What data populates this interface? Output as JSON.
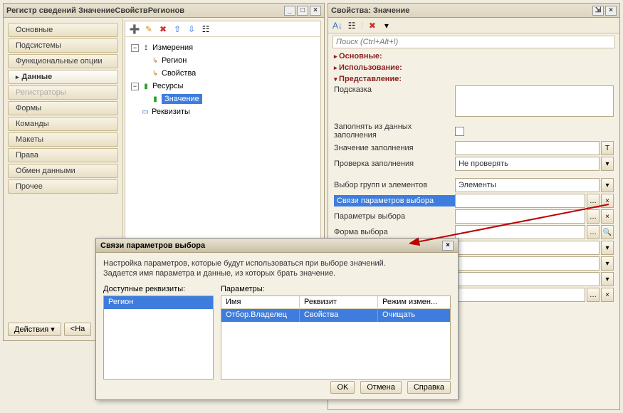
{
  "register": {
    "title": "Регистр сведений ЗначениеСвойствРегионов",
    "nav": [
      "Основные",
      "Подсистемы",
      "Функциональные опции",
      "Данные",
      "Регистраторы",
      "Формы",
      "Команды",
      "Макеты",
      "Права",
      "Обмен данными",
      "Прочее"
    ],
    "nav_active": "Данные",
    "nav_disabled": "Регистраторы",
    "actions": "Действия",
    "back": "<На",
    "tree": {
      "root_dim": "Измерения",
      "dim_region": "Регион",
      "dim_props": "Свойства",
      "root_res": "Ресурсы",
      "res_value": "Значение",
      "root_req": "Реквизиты"
    }
  },
  "props": {
    "title": "Свойства: Значение",
    "search_placeholder": "Поиск (Ctrl+Alt+I)",
    "sections": {
      "main": "Основные:",
      "usage": "Использование:",
      "presentation": "Представление:"
    },
    "rows": {
      "hint": "Подсказка",
      "fill_from_data": "Заполнять из данных заполнения",
      "fill_value": "Значение заполнения",
      "fill_check": "Проверка заполнения",
      "fill_check_val": "Не проверять",
      "group_elem": "Выбор групп и элементов",
      "group_elem_val": "Элементы",
      "link_params": "Связи параметров выбора",
      "sel_params": "Параметры выбора",
      "sel_form": "Форма выбора"
    }
  },
  "dialog": {
    "title": "Связи параметров выбора",
    "desc1": "Настройка параметров, которые будут использоваться при выборе значений.",
    "desc2": "Задается имя параметра и данные, из которых брать значение.",
    "left_label": "Доступные реквизиты:",
    "right_label": "Параметры:",
    "avail": [
      "Регион"
    ],
    "cols": [
      "Имя",
      "Реквизит",
      "Режим измен..."
    ],
    "row": [
      "Отбор.Владелец",
      "Свойства",
      "Очищать"
    ],
    "ok": "OK",
    "cancel": "Отмена",
    "help": "Справка"
  },
  "colors": {
    "accent": "#3e7ddd",
    "danger_text": "#8a1f1f"
  }
}
